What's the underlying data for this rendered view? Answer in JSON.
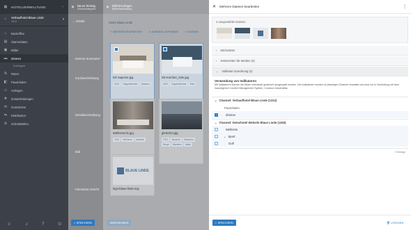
{
  "sidebar": {
    "title": "HOTELVERWALTUNG",
    "hotel_name": "Verbaufhotel Blaue Linde",
    "hotel_id": "1313",
    "items": [
      {
        "label": "Backoffice",
        "icon": "home-icon"
      },
      {
        "label": "Stammdaten",
        "icon": "database-icon"
      },
      {
        "label": "Bilder",
        "icon": "image-icon"
      },
      {
        "label": "Zimmer",
        "icon": "bed-icon"
      },
      {
        "label": "Raten",
        "icon": "rates-icon"
      },
      {
        "label": "Pauschalen",
        "icon": "package-icon"
      },
      {
        "label": "Vorlagen",
        "icon": "template-icon"
      },
      {
        "label": "Zusatzleistungen",
        "icon": "extras-icon"
      },
      {
        "label": "Gutscheine",
        "icon": "voucher-icon"
      },
      {
        "label": "Distribution",
        "icon": "distribution-icon"
      },
      {
        "label": "Schnittstellen",
        "icon": "interface-icon"
      }
    ],
    "active_sub": "Kontingent"
  },
  "panel1": {
    "title": "Neuer Eintrag",
    "subtitle": "Zimmerkategorie",
    "section": "Details",
    "labels": [
      "Interner Kurzname*",
      "Kurzbeschreibung",
      "Detailbeschreibung",
      "Bild",
      "Panorama Ansicht"
    ],
    "save": "SPEICHERN"
  },
  "panel2": {
    "title": "Bild hinzufügen",
    "subtitle": "Bibliothekskatalog",
    "hotel": "Hotel: Blaue Linde",
    "btn_edit": "MEHRERE BEARBEITEN",
    "btn_unselect": "AUSWAHL AUFHEBEN",
    "btn_upload": "DATEIEN",
    "images": [
      {
        "name": "DZ-Superior.jpg",
        "tags": [
          "2021",
          "Doppelzimmer",
          "Superior"
        ],
        "selected": true
      },
      {
        "name": "DZ-Komfort_Solo.jpg",
        "tags": [
          "2021",
          "Doppelzimmer",
          "Solo"
        ],
        "selected": true
      },
      {
        "name": "Wellness-01.jpg",
        "tags": [
          "2022",
          "Wellness",
          "Ausblick"
        ],
        "selected": false
      },
      {
        "name": "gletscher.jpg",
        "tags": [
          "2021",
          "Aussicht",
          "Gletscher",
          "Berge",
          "Wandern",
          "Natur"
        ],
        "selected": false
      },
      {
        "name": "logo-blaue-linde.svg",
        "tags": [],
        "selected": false
      }
    ],
    "logo_text": "BLAUE LINDE",
    "save": "ÜBERNEHMEN"
  },
  "panel3": {
    "title": "Mehrere Dateien bearbeiten",
    "selected_count": "4 ausgewählte Dateien",
    "sections": [
      "Stichwörter",
      "Seiterzeiten für Medien (3)",
      "Indikator-Zuordnung (4)"
    ],
    "info_title": "Verwendung von Indikatoren",
    "info_text": "Mit Indikatoren können die Bilder individuell gesteuert ausgespielt werden. Die Indikatoren werden im jeweiligen Channel verwaltet und sind nur in Verbindung mit dem hauseigenen Content Management System, Condoor verwendbar.",
    "channel1": "Channel: Verbaufhotel Blaue Linde (1313)",
    "channel1_items": [
      {
        "label": "Pauschalen",
        "checked": false,
        "box": false
      },
      {
        "label": "Zimmer",
        "checked": true,
        "box": true
      }
    ],
    "channel2": "Channel: Demohotel Website Blaue Linde (1353)",
    "channel2_items": [
      {
        "label": "Wellness",
        "checked": false
      },
      {
        "label": "Sport",
        "checked": true
      },
      {
        "label": "Golf",
        "checked": false
      }
    ],
    "count": "1 Einträge",
    "save": "SPEICHERN",
    "delete": "LÖSCHEN"
  }
}
